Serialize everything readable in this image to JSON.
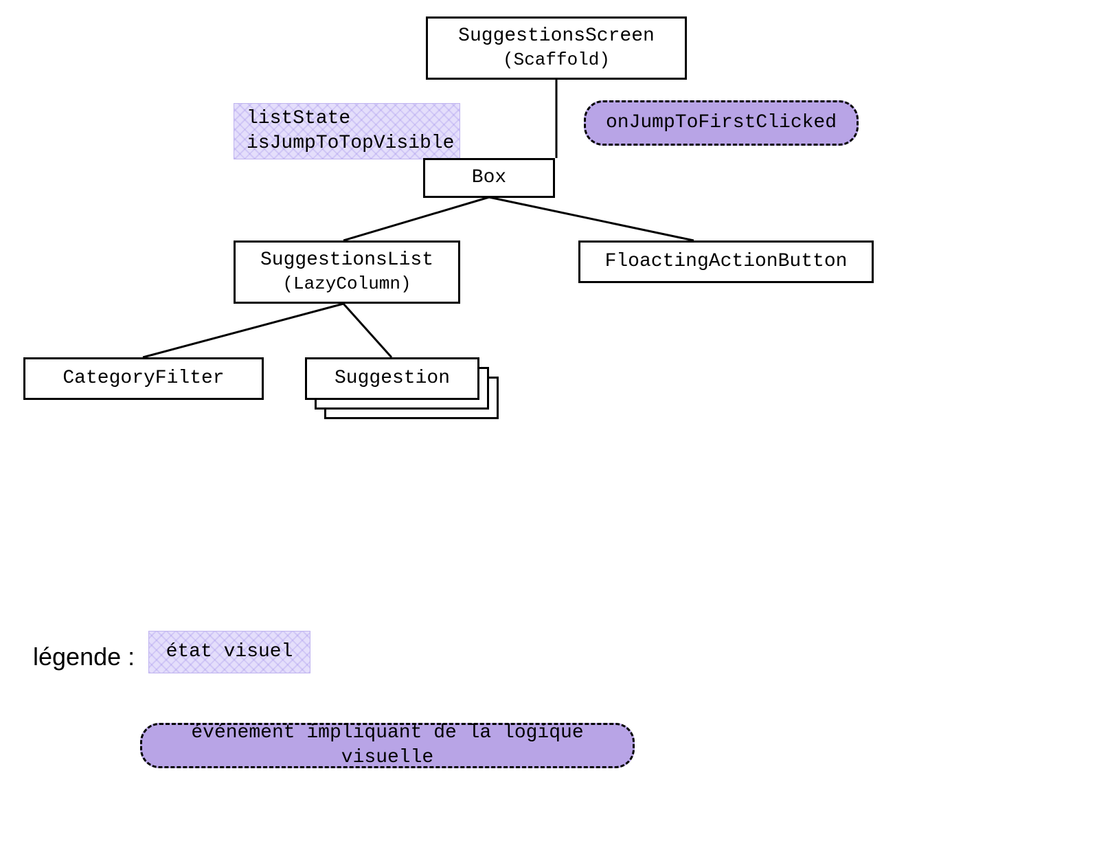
{
  "nodes": {
    "root": {
      "title": "SuggestionsScreen",
      "subtitle": "(Scaffold)"
    },
    "box": {
      "title": "Box"
    },
    "list": {
      "title": "SuggestionsList",
      "subtitle": "(LazyColumn)"
    },
    "fab": {
      "title": "FloactingActionButton"
    },
    "filter": {
      "title": "CategoryFilter"
    },
    "suggestion": {
      "title": "Suggestion"
    }
  },
  "state": {
    "line1": "listState",
    "line2": "isJumpToTopVisible"
  },
  "event": {
    "label": "onJumpToFirstClicked"
  },
  "legend": {
    "label": "légende :",
    "state_label": "état visuel",
    "event_label": "événement impliquant de la logique visuelle"
  },
  "colors": {
    "state_bg": "#e4defb",
    "event_bg": "#b8a4e6",
    "border": "#000000"
  }
}
